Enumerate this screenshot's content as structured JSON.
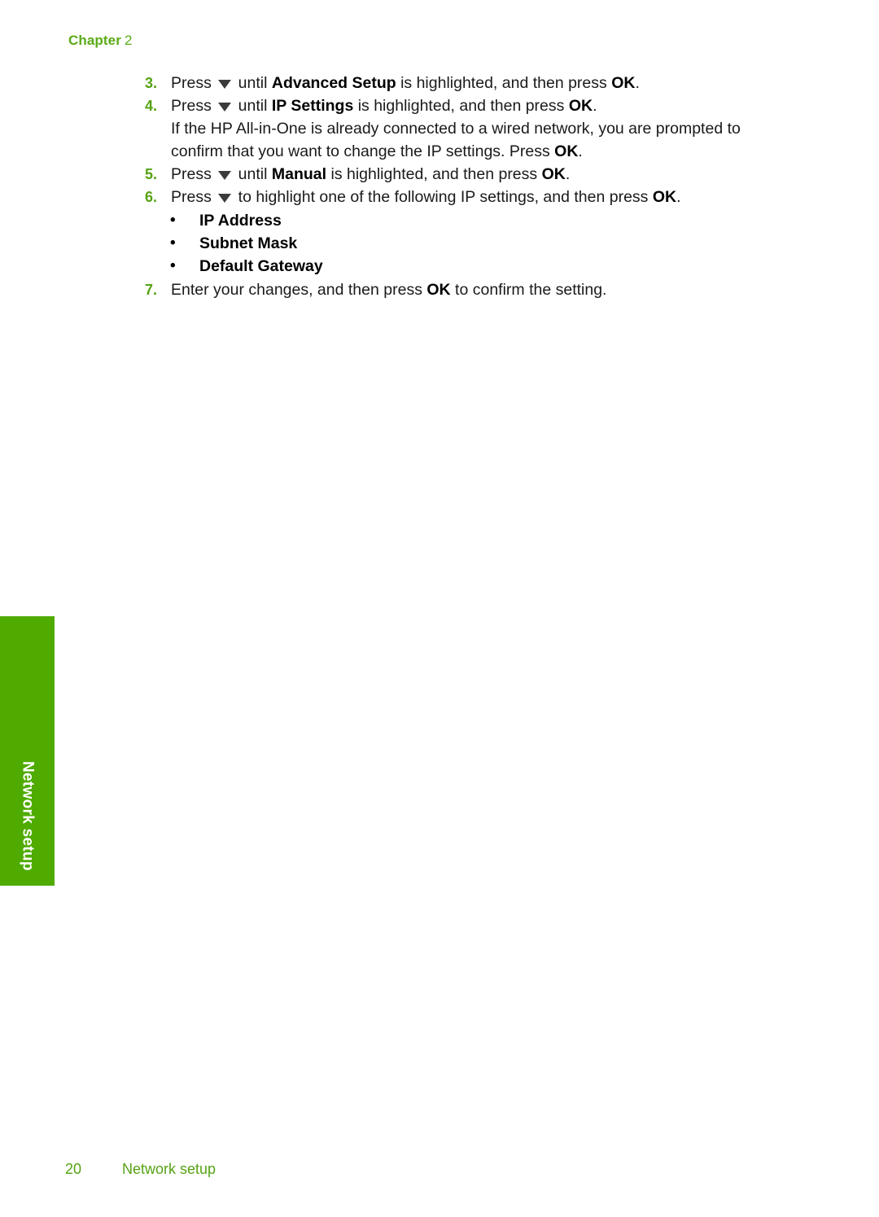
{
  "header": {
    "chapter_label": "Chapter",
    "chapter_number": "2"
  },
  "steps": [
    {
      "number": "3.",
      "lines": [
        {
          "parts": [
            {
              "type": "text",
              "value": "Press "
            },
            {
              "type": "icon",
              "value": "down-arrow-icon"
            },
            {
              "type": "text",
              "value": " until "
            },
            {
              "type": "bold",
              "value": "Advanced Setup"
            },
            {
              "type": "text",
              "value": " is highlighted, and then press "
            },
            {
              "type": "bold",
              "value": "OK"
            },
            {
              "type": "text",
              "value": "."
            }
          ],
          "plain": "Press ▼ until Advanced Setup is highlighted, and then press OK."
        }
      ]
    },
    {
      "number": "4.",
      "lines": [
        {
          "plain": "Press ▼ until IP Settings is highlighted, and then press OK."
        },
        {
          "plain": "If the HP All-in-One is already connected to a wired network, you are prompted to confirm that you want to change the IP settings. Press OK."
        }
      ]
    },
    {
      "number": "5.",
      "lines": [
        {
          "plain": "Press ▼ until Manual is highlighted, and then press OK."
        }
      ]
    },
    {
      "number": "6.",
      "lines": [
        {
          "plain": "Press ▼ to highlight one of the following IP settings, and then press OK."
        }
      ]
    },
    {
      "number": "7.",
      "lines": [
        {
          "plain": "Enter your changes, and then press OK to confirm the setting."
        }
      ]
    }
  ],
  "step3": {
    "pre": "Press ",
    "mid": " until ",
    "bold_term": "Advanced Setup",
    "post": " is highlighted, and then press ",
    "ok": "OK",
    "end": "."
  },
  "step4": {
    "pre": "Press ",
    "mid": " until ",
    "bold_term": "IP Settings",
    "post": " is highlighted, and then press ",
    "ok": "OK",
    "end": ".",
    "note_line1": "If the HP All-in-One is already connected to a wired network, you are prompted to",
    "note_line2_pre": "confirm that you want to change the IP settings. Press ",
    "note_line2_ok": "OK",
    "note_line2_end": "."
  },
  "step5": {
    "pre": "Press ",
    "mid": " until ",
    "bold_term": "Manual",
    "post": " is highlighted, and then press ",
    "ok": "OK",
    "end": "."
  },
  "step6": {
    "pre": "Press ",
    "post": " to highlight one of the following IP settings, and then press ",
    "ok": "OK",
    "end": "."
  },
  "step7": {
    "pre": "Enter your changes, and then press ",
    "ok": "OK",
    "post": " to confirm the setting."
  },
  "ip_settings_bullets": [
    {
      "bullet": "•",
      "label": "IP Address"
    },
    {
      "bullet": "•",
      "label": "Subnet Mask"
    },
    {
      "bullet": "•",
      "label": "Default Gateway"
    }
  ],
  "side_tab": {
    "label": "Network setup"
  },
  "footer": {
    "page_number": "20",
    "title": "Network setup"
  },
  "colors": {
    "accent_green": "#55a313",
    "tab_green": "#4fab00",
    "body_text": "#1a1a1a",
    "bold_text": "#000000",
    "page_background": "#ffffff"
  }
}
